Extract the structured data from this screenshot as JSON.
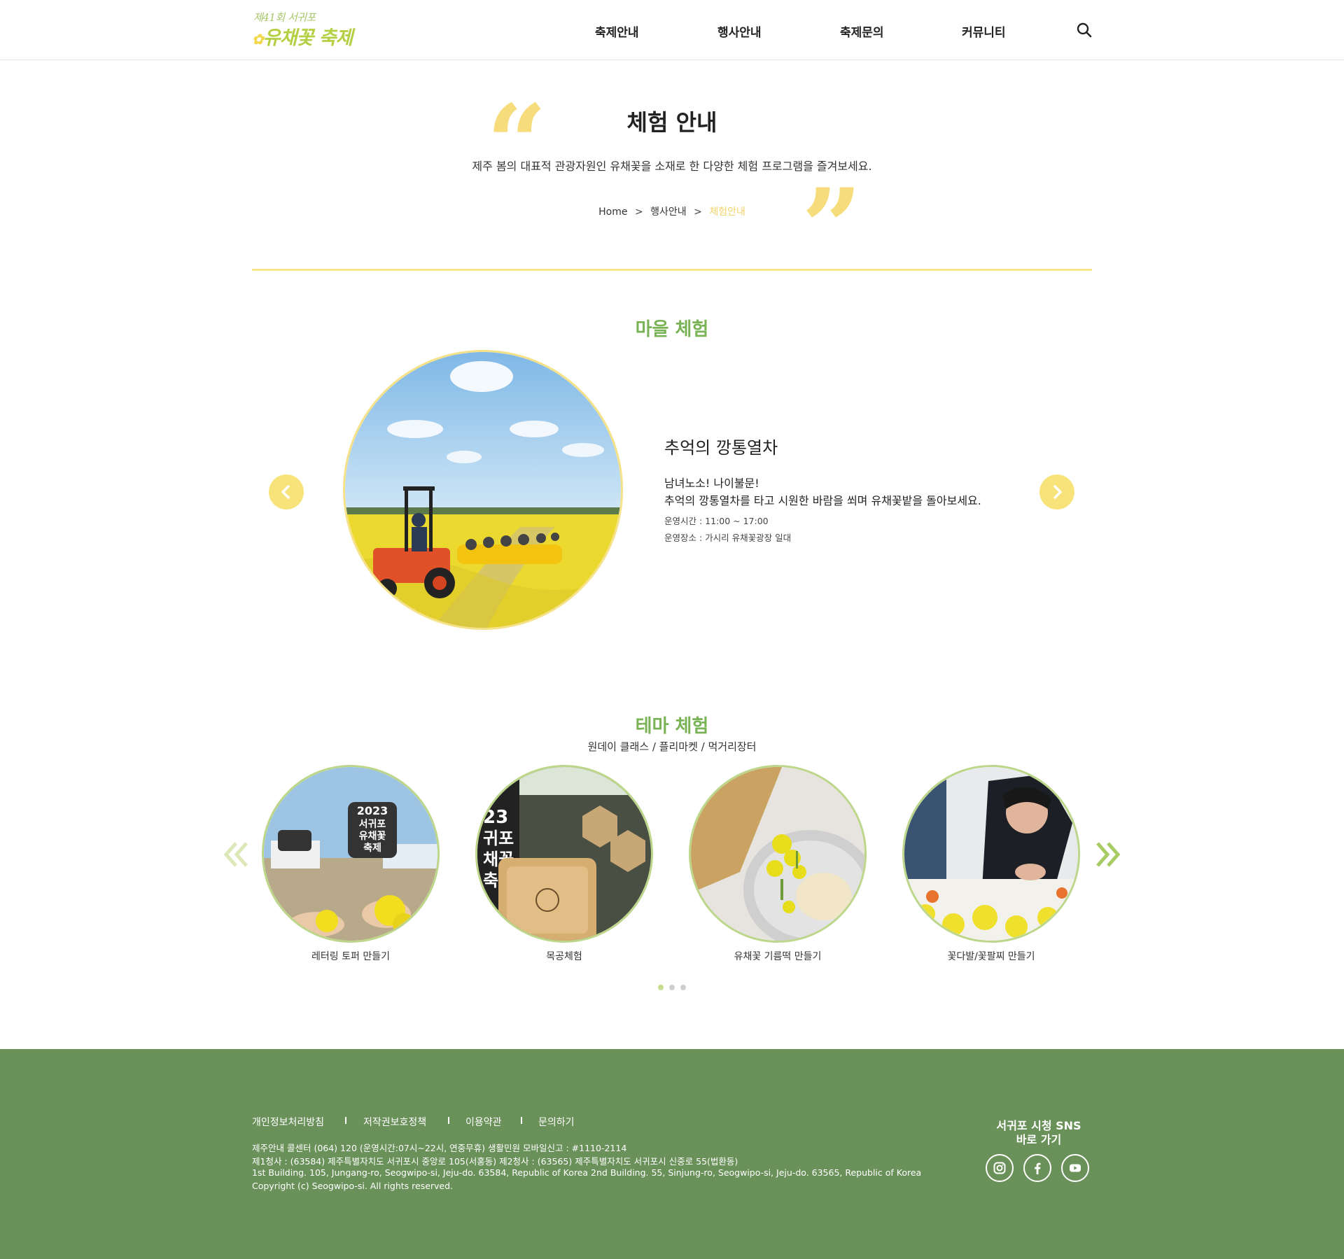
{
  "header": {
    "logo_line1": "제41회 서귀포",
    "logo_line2": "유채꽃 축제",
    "nav": [
      "축제안내",
      "행사안내",
      "축제문의",
      "커뮤니티"
    ]
  },
  "hero": {
    "title": "체험 안내",
    "intro": "제주 봄의 대표적 관광자원인 유채꽃을 소재로 한 다양한 체험 프로그램을 즐겨보세요.",
    "breadcrumb": [
      "Home",
      "행사안내",
      "체험안내"
    ]
  },
  "village": {
    "section_title": "마을 체험",
    "item_title": "추억의 깡통열차",
    "line1": "남녀노소! 나이불문!",
    "line2": "추억의 깡통열차를 타고 시원한 바람을 쐬며 유채꽃밭을 돌아보세요.",
    "hours": "운영시간 : 11:00 ~ 17:00",
    "place": "운영장소 : 가시리 유채꽃광장 일대"
  },
  "theme": {
    "section_title": "테마 체험",
    "subtitle": "원데이 클래스 / 플리마켓 / 먹거리장터",
    "items": [
      "레터링 토퍼 만들기",
      "목공체험",
      "유채꽃 기름떡 만들기",
      "꽃다발/꽃팔찌 만들기"
    ],
    "photo_texts": [
      "2023 서귀포 유채꽃 축제",
      "23 귀포 채꽃 축제"
    ]
  },
  "footer": {
    "links": [
      "개인정보처리방침",
      "저작권보호정책",
      "이용약관",
      "문의하기"
    ],
    "info1": "제주안내 콜센터 (064) 120 (운영시간:07시~22시, 연중무휴) 생활민원 모바일신고 : #1110-2114",
    "info2": "제1청사 : (63584) 제주특별자치도 서귀포시 중앙로 105(서홍동) 제2청사 : (63565) 제주특별자치도 서귀포시 신중로 55(법환동)",
    "info3": "1st Building. 105, Jungang-ro, Seogwipo-si, Jeju-do. 63584, Republic of Korea  2nd Building. 55, Sinjung-ro, Seogwipo-si, Jeju-do. 63565, Republic of Korea",
    "copyright": "Copyright (c) Seogwipo-si. All rights reserved.",
    "sns_title_1": "서귀포 시청 SNS",
    "sns_title_2": "바로 가기"
  },
  "colors": {
    "accent_yellow": "#f7e37a",
    "section_green": "#7ab356",
    "footer_green": "#6a915a"
  },
  "icons": [
    "search-icon",
    "chevron-left-icon",
    "chevron-right-icon",
    "double-chevron-left-icon",
    "double-chevron-right-icon",
    "instagram-icon",
    "facebook-icon",
    "youtube-icon"
  ]
}
